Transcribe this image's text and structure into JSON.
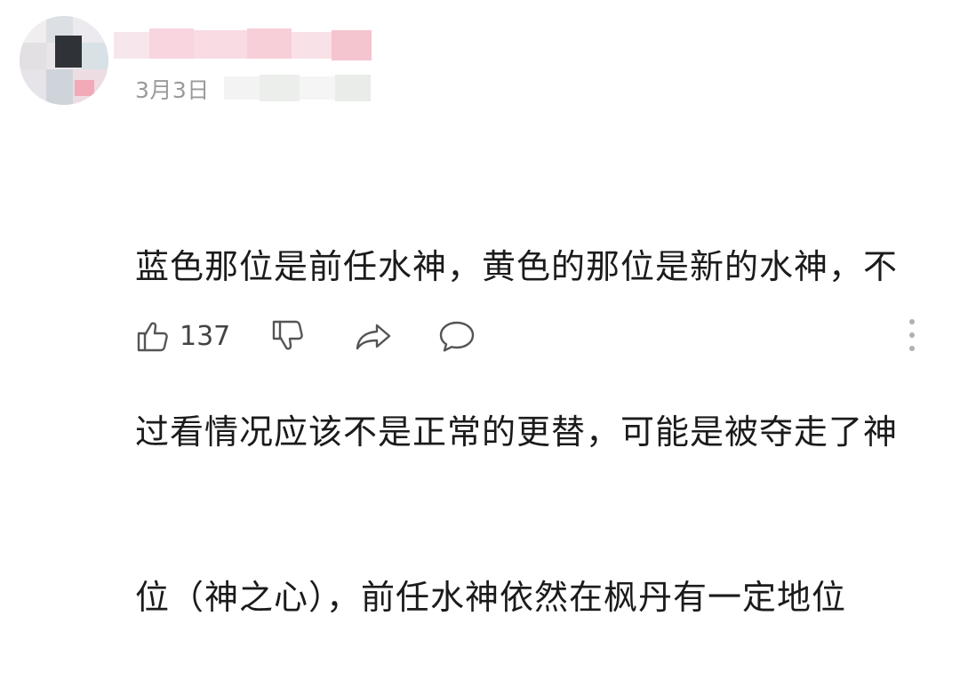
{
  "comment": {
    "date": "3月3日",
    "lines": [
      "蓝色那位是前任水神，黄色的那位是新的水神，不",
      "过看情况应该不是正常的更替，可能是被夺走了神",
      "位（神之心），前任水神依然在枫丹有一定地位"
    ]
  },
  "actions": {
    "like_count": "137",
    "like_icon": "thumbs-up-icon",
    "dislike_icon": "thumbs-down-icon",
    "share_icon": "share-arrow-icon",
    "reply_icon": "comment-bubble-icon",
    "more_icon": "more-vertical-icon"
  },
  "colors": {
    "text": "#1b1b1b",
    "muted": "#9a9a9a",
    "icon": "#555555"
  }
}
